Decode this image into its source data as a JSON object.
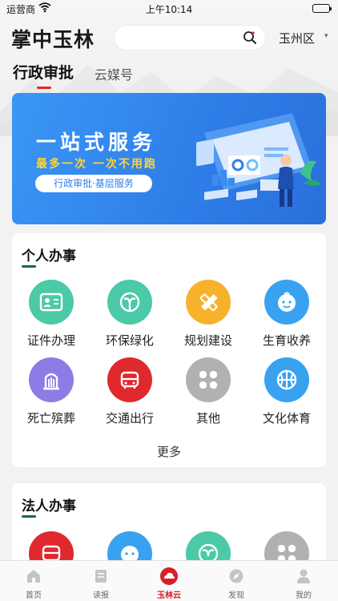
{
  "status_bar": {
    "carrier": "运营商",
    "time": "上午10:14"
  },
  "header": {
    "logo": "掌中玉林",
    "search_placeholder": "",
    "region": "玉州区",
    "region_arrow": "▾"
  },
  "tabs": [
    {
      "label": "行政审批",
      "active": true
    },
    {
      "label": "云媒号",
      "active": false
    }
  ],
  "banner": {
    "title": "一站式服务",
    "subtitle": "最多一次 一次不用跑",
    "pill": "行政审批·基层服务"
  },
  "personal": {
    "title": "个人办事",
    "services": [
      {
        "label": "证件办理",
        "icon": "id-card-icon",
        "color": "#4cc9a7"
      },
      {
        "label": "环保绿化",
        "icon": "leaf-icon",
        "color": "#4cc9a7"
      },
      {
        "label": "规划建设",
        "icon": "ruler-pencil-icon",
        "color": "#f7b22c"
      },
      {
        "label": "生育收养",
        "icon": "baby-face-icon",
        "color": "#38a2f0"
      },
      {
        "label": "死亡殡葬",
        "icon": "memorial-icon",
        "color": "#8d7ce6"
      },
      {
        "label": "交通出行",
        "icon": "bus-icon",
        "color": "#e0292f"
      },
      {
        "label": "其他",
        "icon": "grid-icon",
        "color": "#b1b1b1"
      },
      {
        "label": "文化体育",
        "icon": "basketball-icon",
        "color": "#38a2f0"
      }
    ],
    "more": "更多"
  },
  "legal": {
    "title": "法人办事",
    "services": [
      {
        "icon": "bus-icon",
        "color": "#e0292f"
      },
      {
        "icon": "baby-face-icon",
        "color": "#38a2f0"
      },
      {
        "icon": "leaf-icon",
        "color": "#4cc9a7"
      },
      {
        "icon": "grid-icon",
        "color": "#b1b1b1"
      }
    ]
  },
  "bottom_nav": [
    {
      "label": "首页",
      "icon": "home-icon",
      "active": false
    },
    {
      "label": "读报",
      "icon": "newspaper-icon",
      "active": false
    },
    {
      "label": "玉林云",
      "icon": "cloud-icon",
      "active": true
    },
    {
      "label": "发现",
      "icon": "compass-icon",
      "active": false
    },
    {
      "label": "我的",
      "icon": "user-icon",
      "active": false
    }
  ],
  "colors": {
    "accent_red": "#e0262b",
    "banner_blue": "#2f7fe9",
    "banner_yellow": "#ffd437",
    "section_green": "#1c6a35"
  }
}
